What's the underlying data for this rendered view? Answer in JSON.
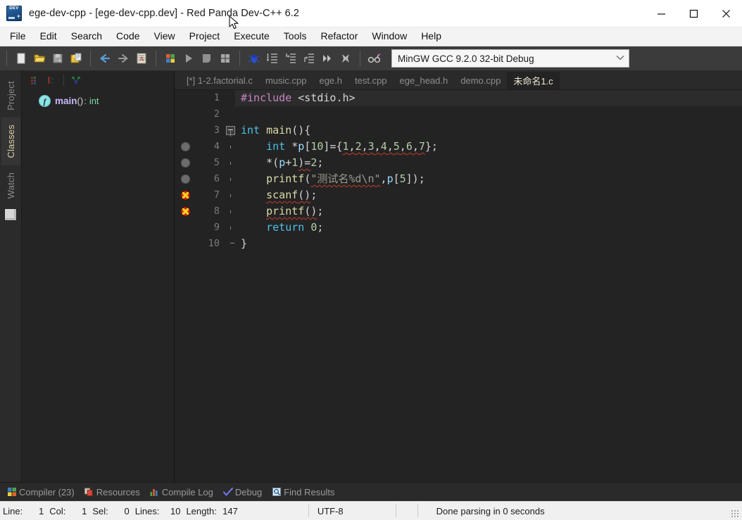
{
  "window": {
    "title": "ege-dev-cpp - [ege-dev-cpp.dev] - Red Panda Dev-C++ 6.2",
    "app_icon": "dev-cpp-icon",
    "minimize_label": "minimize-icon",
    "maximize_label": "maximize-icon",
    "close_label": "close-icon"
  },
  "menubar": {
    "items": [
      {
        "label": "File"
      },
      {
        "label": "Edit"
      },
      {
        "label": "Search"
      },
      {
        "label": "Code"
      },
      {
        "label": "View"
      },
      {
        "label": "Project"
      },
      {
        "label": "Execute"
      },
      {
        "label": "Tools"
      },
      {
        "label": "Refactor"
      },
      {
        "label": "Window"
      },
      {
        "label": "Help"
      }
    ]
  },
  "toolbar": {
    "groups": [
      [
        "new-file-icon",
        "open-folder-icon",
        "save-icon",
        "save-all-icon"
      ],
      [
        "back-arrow-icon",
        "forward-arrow-icon",
        "find-icon"
      ],
      [
        "compile-icon",
        "run-icon",
        "stop-icon",
        "compile-run-icon"
      ],
      [
        "debug-bug-icon",
        "step-over-icon",
        "step-into-icon",
        "step-out-icon",
        "continue-icon",
        "stop-debug-icon"
      ],
      [
        "add-watch-icon"
      ]
    ],
    "compiler_set": {
      "value": "MinGW GCC 9.2.0 32-bit Debug",
      "arrow": "chevron-down-icon"
    }
  },
  "sidebar": {
    "vertical_tabs": [
      {
        "label": "Project",
        "active": false
      },
      {
        "label": "Classes",
        "active": true
      },
      {
        "label": "Watch",
        "active": false
      }
    ],
    "panel_toolbar": [
      "sort-alpha-icon",
      "sort-order-icon",
      "show-inherited-icon"
    ],
    "tree": [
      {
        "icon": "function-icon",
        "name": "main",
        "args": "()",
        "sep": ":",
        "type": "int"
      }
    ]
  },
  "editor": {
    "tabs": [
      {
        "label": "[*] 1-2.factorial.c",
        "active": false
      },
      {
        "label": "music.cpp",
        "active": false
      },
      {
        "label": "ege.h",
        "active": false
      },
      {
        "label": "test.cpp",
        "active": false
      },
      {
        "label": "ege_head.h",
        "active": false
      },
      {
        "label": "demo.cpp",
        "active": false
      },
      {
        "label": "未命名1.c",
        "active": true
      }
    ],
    "lines": [
      {
        "num": "1",
        "marker": "none",
        "fold": "none",
        "active": true
      },
      {
        "num": "2",
        "marker": "none",
        "fold": "none",
        "active": false
      },
      {
        "num": "3",
        "marker": "none",
        "fold": "open",
        "active": false
      },
      {
        "num": "4",
        "marker": "gray",
        "fold": "mid",
        "active": false
      },
      {
        "num": "5",
        "marker": "gray",
        "fold": "mid",
        "active": false
      },
      {
        "num": "6",
        "marker": "gray",
        "fold": "mid",
        "active": false
      },
      {
        "num": "7",
        "marker": "error",
        "fold": "mid",
        "active": false
      },
      {
        "num": "8",
        "marker": "error",
        "fold": "mid",
        "active": false
      },
      {
        "num": "9",
        "marker": "none",
        "fold": "mid",
        "active": false
      },
      {
        "num": "10",
        "marker": "none",
        "fold": "end",
        "active": false
      }
    ],
    "source_text": [
      "#include <stdio.h>",
      "",
      "int main(){",
      "    int *p[10]={1,2,3,4,5,6,7};",
      "    *(p+1)=2;",
      "    printf(\"测试名%d\\n\",p[5]);",
      "    scanf();",
      "    printf();",
      "    return 0;",
      "}"
    ]
  },
  "bottom_tabs": [
    {
      "label": "Compiler (23)",
      "icon": "compiler-icon"
    },
    {
      "label": "Resources",
      "icon": "resources-icon"
    },
    {
      "label": "Compile Log",
      "icon": "compile-log-icon"
    },
    {
      "label": "Debug",
      "icon": "debug-check-icon"
    },
    {
      "label": "Find Results",
      "icon": "find-results-icon"
    }
  ],
  "statusbar": {
    "line_label": "Line:",
    "line_value": "1",
    "col_label": "Col:",
    "col_value": "1",
    "sel_label": "Sel:",
    "sel_value": "0",
    "lines_label": "Lines:",
    "lines_value": "10",
    "length_label": "Length:",
    "length_value": "147",
    "encoding": "UTF-8",
    "message": "Done parsing in 0 seconds"
  },
  "colors": {
    "accent": "#4ec0e6",
    "error": "#d12a18",
    "warning": "#f5d21a",
    "editor_bg": "#232323",
    "panel_bg": "#242424",
    "toolbar_bg": "#3b3b3b"
  }
}
